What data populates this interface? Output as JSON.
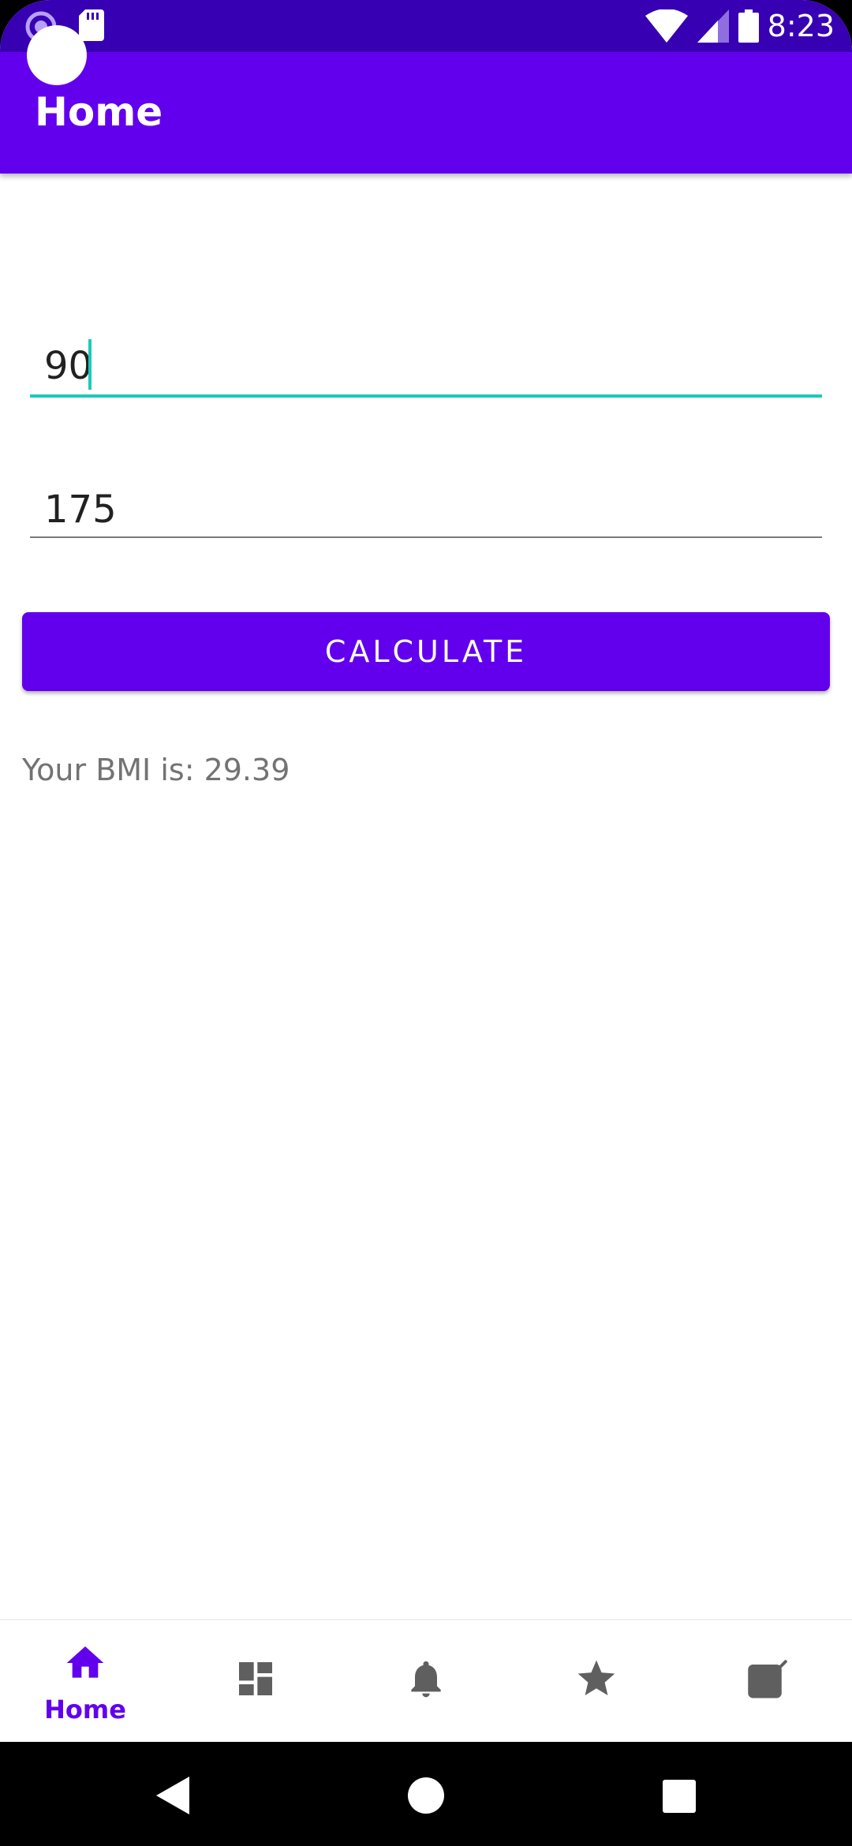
{
  "status_bar": {
    "time": "8:23",
    "icons": [
      "notification-app-icon",
      "sd-card-icon",
      "wifi-icon",
      "cell-signal-icon",
      "battery-icon"
    ]
  },
  "app_bar": {
    "title": "Home"
  },
  "form": {
    "weight_value": "90",
    "height_value": "175",
    "calculate_label": "CALCULATE",
    "result_text": "Your BMI is: 29.39"
  },
  "bottom_nav": {
    "items": [
      {
        "label": "Home",
        "icon": "home-icon",
        "active": true
      },
      {
        "label": "",
        "icon": "dashboard-icon",
        "active": false
      },
      {
        "label": "",
        "icon": "notifications-icon",
        "active": false
      },
      {
        "label": "",
        "icon": "star-icon",
        "active": false
      },
      {
        "label": "",
        "icon": "edit-icon",
        "active": false
      }
    ]
  },
  "colors": {
    "primary": "#6200ee",
    "primary_dark": "#3700b3",
    "accent": "#1dc9b8"
  }
}
